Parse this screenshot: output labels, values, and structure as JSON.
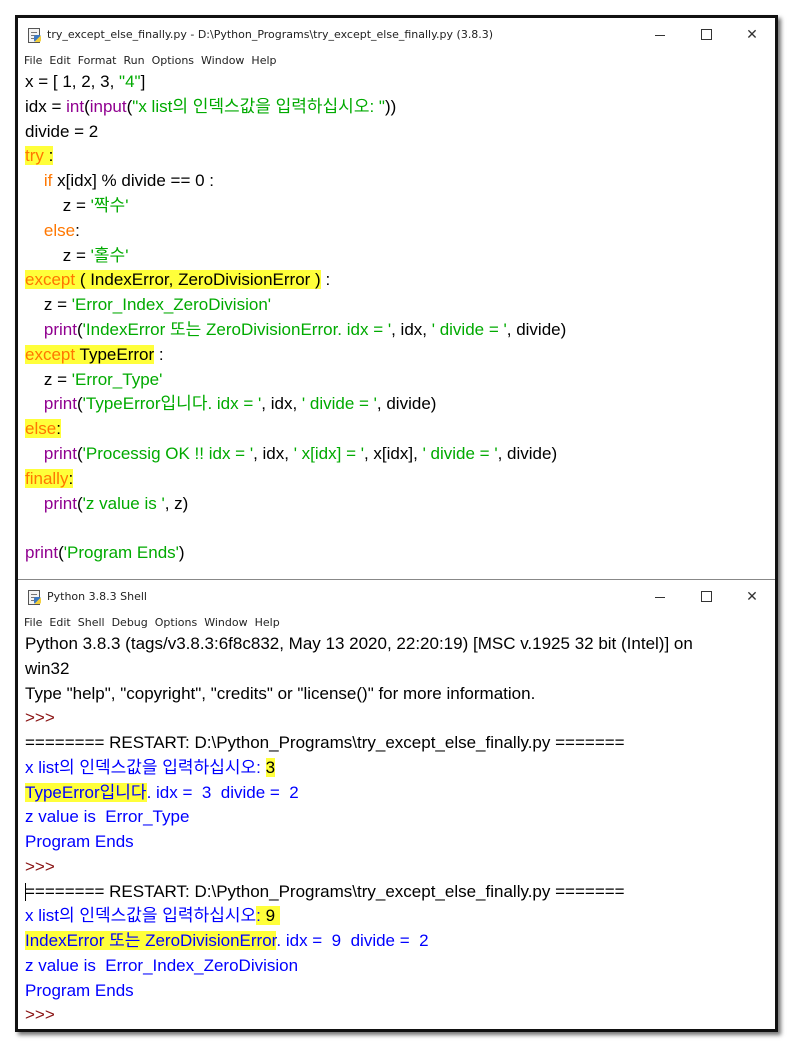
{
  "editor": {
    "title": "try_except_else_finally.py - D:\\Python_Programs\\try_except_else_finally.py (3.8.3)",
    "menu": [
      "File",
      "Edit",
      "Format",
      "Run",
      "Options",
      "Window",
      "Help"
    ],
    "lines": [
      [
        [
          "d",
          "x = [ 1, 2, 3, "
        ],
        [
          "s",
          "\"4\""
        ],
        [
          "d",
          "]"
        ]
      ],
      [
        [
          "d",
          "idx = "
        ],
        [
          "b",
          "int"
        ],
        [
          "d",
          "("
        ],
        [
          "b",
          "input"
        ],
        [
          "d",
          "("
        ],
        [
          "s",
          "\"x list의 인덱스값을 입력하십시오: \""
        ],
        [
          "d",
          "))"
        ]
      ],
      [
        [
          "d",
          "divide = 2"
        ]
      ],
      [
        [
          "k",
          "try",
          "hl"
        ],
        [
          "d",
          " :",
          "hl"
        ]
      ],
      [
        [
          "d",
          "    "
        ],
        [
          "k",
          "if"
        ],
        [
          "d",
          " x[idx] % divide == 0 :"
        ]
      ],
      [
        [
          "d",
          "        z = "
        ],
        [
          "s",
          "'짝수'"
        ]
      ],
      [
        [
          "d",
          "    "
        ],
        [
          "k",
          "else"
        ],
        [
          "d",
          ":"
        ]
      ],
      [
        [
          "d",
          "        z = "
        ],
        [
          "s",
          "'홀수'"
        ]
      ],
      [
        [
          "k",
          "except",
          "hl"
        ],
        [
          "d",
          " ( IndexError, ZeroDivisionError )",
          "hl"
        ],
        [
          "d",
          " :"
        ]
      ],
      [
        [
          "d",
          "    z = "
        ],
        [
          "s",
          "'Error_Index_ZeroDivision'"
        ]
      ],
      [
        [
          "d",
          "    "
        ],
        [
          "b",
          "print"
        ],
        [
          "d",
          "("
        ],
        [
          "s",
          "'IndexError 또는 ZeroDivisionError. idx = '"
        ],
        [
          "d",
          ", idx, "
        ],
        [
          "s",
          "' divide = '"
        ],
        [
          "d",
          ", divide)"
        ]
      ],
      [
        [
          "k",
          "except",
          "hl"
        ],
        [
          "d",
          " TypeError",
          "hl"
        ],
        [
          "d",
          " :"
        ]
      ],
      [
        [
          "d",
          "    z = "
        ],
        [
          "s",
          "'Error_Type'"
        ]
      ],
      [
        [
          "d",
          "    "
        ],
        [
          "b",
          "print"
        ],
        [
          "d",
          "("
        ],
        [
          "s",
          "'TypeError입니다. idx = '"
        ],
        [
          "d",
          ", idx, "
        ],
        [
          "s",
          "' divide = '"
        ],
        [
          "d",
          ", divide)"
        ]
      ],
      [
        [
          "k",
          "else",
          "hl"
        ],
        [
          "d",
          ":",
          "hl"
        ]
      ],
      [
        [
          "d",
          "    "
        ],
        [
          "b",
          "print"
        ],
        [
          "d",
          "("
        ],
        [
          "s",
          "'Processig OK !! idx = '"
        ],
        [
          "d",
          ", idx, "
        ],
        [
          "s",
          "' x[idx] = '"
        ],
        [
          "d",
          ", x[idx], "
        ],
        [
          "s",
          "' divide = '"
        ],
        [
          "d",
          ", divide)"
        ]
      ],
      [
        [
          "k",
          "finally",
          "hl"
        ],
        [
          "d",
          ":",
          "hl"
        ]
      ],
      [
        [
          "d",
          "    "
        ],
        [
          "b",
          "print"
        ],
        [
          "d",
          "("
        ],
        [
          "s",
          "'z value is '"
        ],
        [
          "d",
          ", z)"
        ]
      ],
      [],
      [
        [
          "b",
          "print"
        ],
        [
          "d",
          "("
        ],
        [
          "s",
          "'Program Ends'"
        ],
        [
          "d",
          ")"
        ]
      ]
    ]
  },
  "shell": {
    "title": "Python 3.8.3 Shell",
    "menu": [
      "File",
      "Edit",
      "Shell",
      "Debug",
      "Options",
      "Window",
      "Help"
    ],
    "lines": [
      [
        [
          "e",
          "Python 3.8.3 (tags/v3.8.3:6f8c832, May 13 2020, 22:20:19) [MSC v.1925 32 bit (Intel)] on"
        ]
      ],
      [
        [
          "e",
          "win32"
        ]
      ],
      [
        [
          "e",
          "Type \"help\", \"copyright\", \"credits\" or \"license()\" for more information."
        ]
      ],
      [
        [
          "p",
          ">>> "
        ]
      ],
      [
        [
          "e",
          "======== RESTART: D:\\Python_Programs\\try_except_else_finally.py ======="
        ]
      ],
      [
        [
          "o",
          "x list의 인덱스값을 입력하십시오: "
        ],
        [
          "e",
          "3",
          "hl"
        ]
      ],
      [
        [
          "o",
          "TypeError입니다",
          "hl"
        ],
        [
          "o",
          ". idx =  3  divide =  2"
        ]
      ],
      [
        [
          "o",
          "z value is  Error_Type"
        ]
      ],
      [
        [
          "o",
          "Program Ends"
        ]
      ],
      [
        [
          "p",
          ">>> "
        ]
      ],
      [
        [
          "e",
          "======== RESTART: D:\\Python_Programs\\try_except_else_finally.py ======="
        ]
      ],
      [
        [
          "o",
          "x list의 인덱스값을 입력하십시오"
        ],
        [
          "o",
          ": ",
          "hl"
        ],
        [
          "e",
          "9",
          "hl"
        ],
        [
          "e",
          " ",
          "hl"
        ]
      ],
      [
        [
          "o",
          "IndexError 또는 ZeroDivisionError",
          "hl"
        ],
        [
          "o",
          ". idx =  9  divide =  2"
        ]
      ],
      [
        [
          "o",
          "z value is  Error_Index_ZeroDivision"
        ]
      ],
      [
        [
          "o",
          "Program Ends"
        ]
      ],
      [
        [
          "p",
          ">>> "
        ]
      ]
    ]
  },
  "window_controls": {
    "minimize": "—",
    "maximize": "☐",
    "close": "✕"
  }
}
